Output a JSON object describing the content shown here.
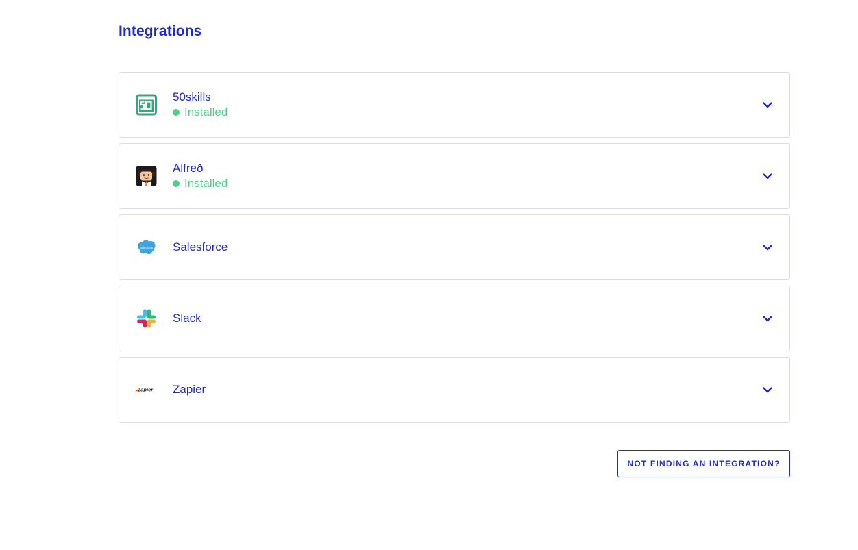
{
  "page": {
    "title": "Integrations"
  },
  "integrations": [
    {
      "name": "50skills",
      "status": "Installed",
      "icon": "50skills-logo-icon"
    },
    {
      "name": "Alfreð",
      "status": "Installed",
      "icon": "alfred-logo-icon"
    },
    {
      "name": "Salesforce",
      "status": "",
      "icon": "salesforce-logo-icon",
      "logo_text": "salesforce"
    },
    {
      "name": "Slack",
      "status": "",
      "icon": "slack-logo-icon"
    },
    {
      "name": "Zapier",
      "status": "",
      "icon": "zapier-logo-icon",
      "logo_text": "zapier"
    }
  ],
  "cta": {
    "label": "NOT FINDING AN INTEGRATION?"
  },
  "colors": {
    "accent": "#1f2bd6",
    "installed": "#4ccf86",
    "border": "#dcdde3"
  }
}
